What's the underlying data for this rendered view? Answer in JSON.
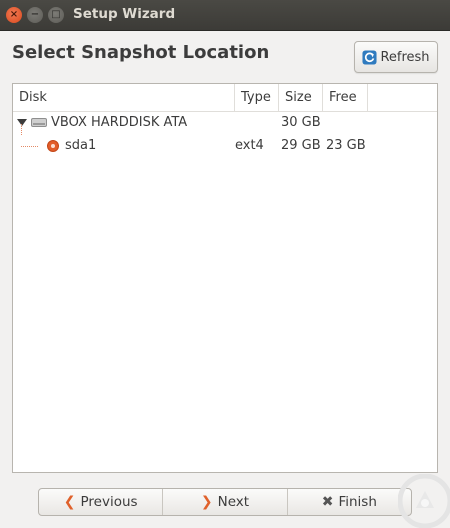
{
  "window": {
    "title": "Setup Wizard",
    "close_glyph": "×",
    "min_glyph": "−",
    "max_glyph": "□"
  },
  "header": {
    "title": "Select Snapshot Location",
    "refresh_label": "Refresh"
  },
  "tree": {
    "columns": [
      "Disk",
      "Type",
      "Size",
      "Free"
    ],
    "disk": {
      "name": "VBOX HARDDISK ATA",
      "type": "",
      "size": "30 GB",
      "free": ""
    },
    "partition": {
      "name": "sda1",
      "type": "ext4",
      "size": "29 GB",
      "free": "23 GB"
    }
  },
  "nav": {
    "previous_label": "Previous",
    "next_label": "Next",
    "finish_label": "Finish",
    "previous_icon": "❮",
    "next_icon": "❯",
    "finish_icon": "✖"
  },
  "colors": {
    "accent": "#e0612b",
    "titlebar": "#3c3b37",
    "watermark": "#e0e0e0"
  }
}
